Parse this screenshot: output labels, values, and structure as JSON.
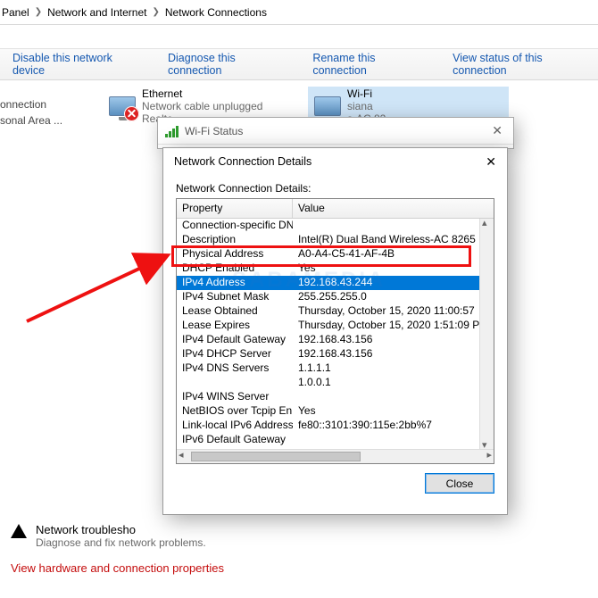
{
  "breadcrumb": {
    "panel": "Panel",
    "net": "Network and Internet",
    "conn": "Network Connections"
  },
  "toolbar": {
    "disable": "Disable this network device",
    "diagnose": "Diagnose this connection",
    "rename": "Rename this connection",
    "viewstatus": "View status of this connection"
  },
  "sidebar": {
    "l1": "onnection",
    "l2": "sonal Area ..."
  },
  "adapters": {
    "ethernet": {
      "name": "Ethernet",
      "sub1": "Network cable unplugged",
      "sub2": "Realte"
    },
    "wifi": {
      "name": "Wi-Fi",
      "sub1": "siana",
      "sub2": "s-AC 82..."
    }
  },
  "statusWindow": {
    "title": "Wi-Fi Status"
  },
  "detailsWindow": {
    "title": "Network Connection Details",
    "caption": "Network Connection Details:",
    "header": {
      "prop": "Property",
      "val": "Value"
    },
    "rows": [
      {
        "prop": "Connection-specific DN...",
        "val": ""
      },
      {
        "prop": "Description",
        "val": "Intel(R) Dual Band Wireless-AC 8265"
      },
      {
        "prop": "Physical Address",
        "val": "A0-A4-C5-41-AF-4B"
      },
      {
        "prop": "DHCP Enabled",
        "val": "Yes"
      },
      {
        "prop": "IPv4 Address",
        "val": "192.168.43.244",
        "selected": true
      },
      {
        "prop": "IPv4 Subnet Mask",
        "val": "255.255.255.0"
      },
      {
        "prop": "Lease Obtained",
        "val": "Thursday, October 15, 2020 11:00:57"
      },
      {
        "prop": "Lease Expires",
        "val": "Thursday, October 15, 2020 1:51:09 P"
      },
      {
        "prop": "IPv4 Default Gateway",
        "val": "192.168.43.156"
      },
      {
        "prop": "IPv4 DHCP Server",
        "val": "192.168.43.156"
      },
      {
        "prop": "IPv4 DNS Servers",
        "val": "1.1.1.1"
      },
      {
        "prop": "",
        "val": "1.0.0.1"
      },
      {
        "prop": "IPv4 WINS Server",
        "val": ""
      },
      {
        "prop": "NetBIOS over Tcpip En...",
        "val": "Yes"
      },
      {
        "prop": "Link-local IPv6 Address",
        "val": "fe80::3101:390:115e:2bb%7"
      },
      {
        "prop": "IPv6 Default Gateway",
        "val": ""
      }
    ],
    "closeBtn": "Close"
  },
  "troubleshoot": {
    "title": "Network troublesho",
    "sub": "Diagnose and fix network problems."
  },
  "hwlink": "View hardware and connection properties",
  "watermark": "SABAMEDIA"
}
